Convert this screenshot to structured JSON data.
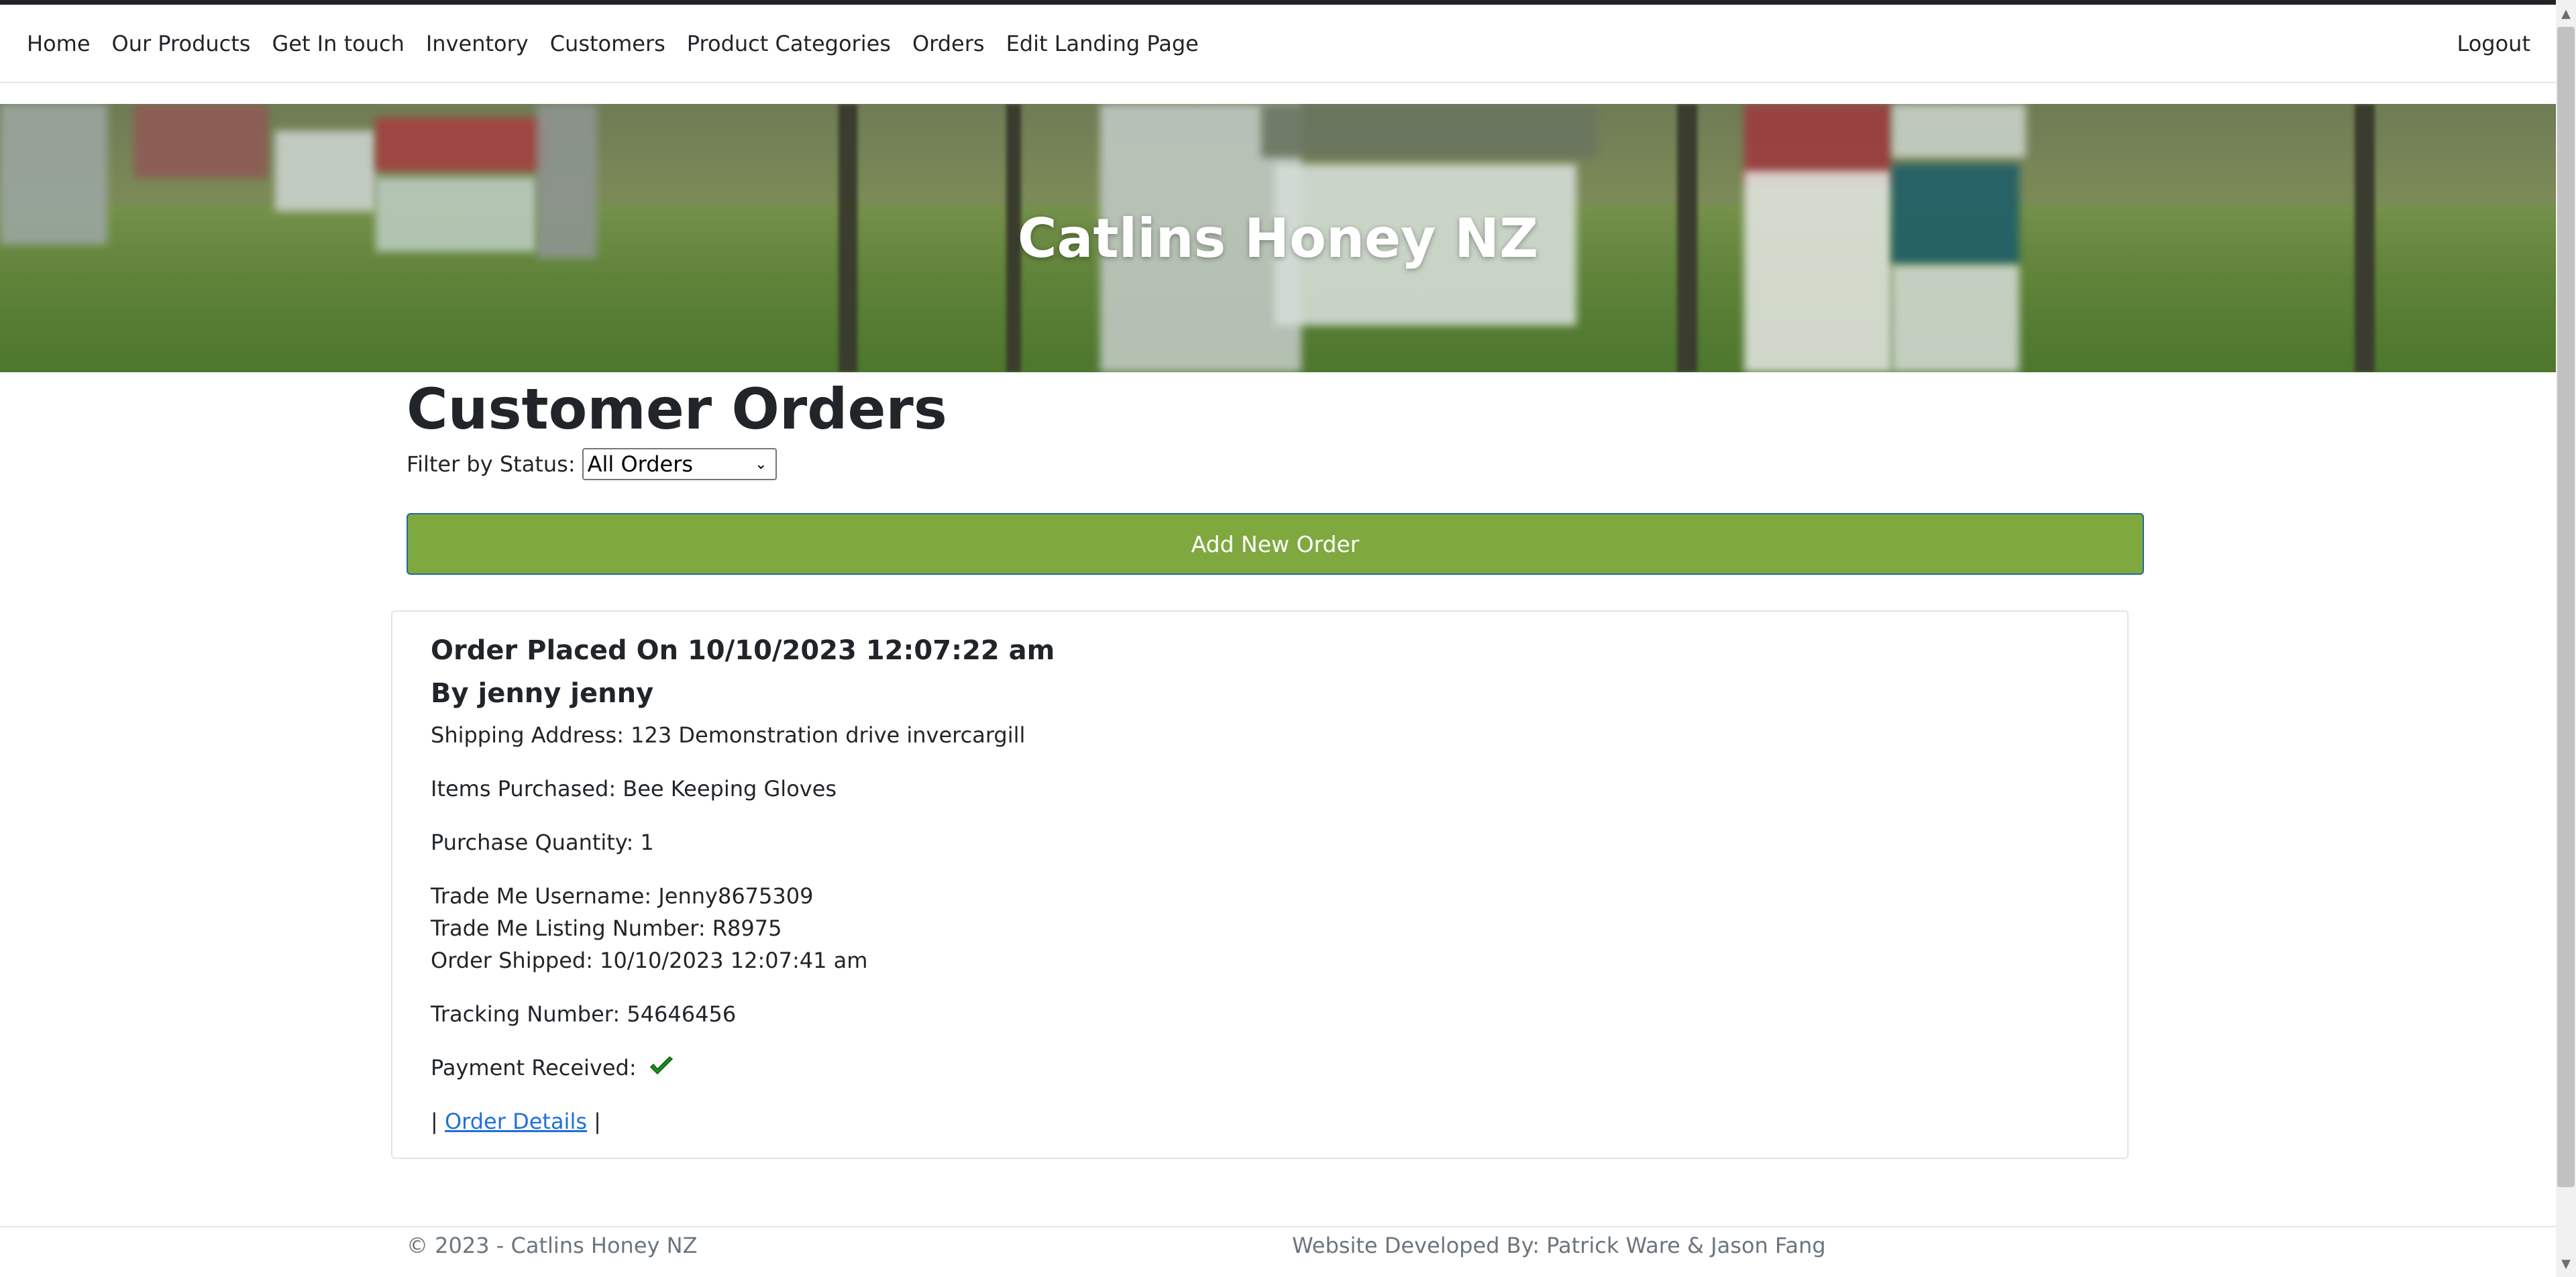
{
  "nav": {
    "links": [
      "Home",
      "Our Products",
      "Get In touch",
      "Inventory",
      "Customers",
      "Product Categories",
      "Orders",
      "Edit Landing Page"
    ],
    "logout": "Logout"
  },
  "hero": {
    "title": "Catlins Honey NZ"
  },
  "main": {
    "title": "Customer Orders",
    "filter_label": "Filter by Status:",
    "filter_value": "All Orders",
    "add_button": "Add New Order"
  },
  "order": {
    "placed": "Order Placed On 10/10/2023 12:07:22 am",
    "by": "By jenny jenny",
    "shipping": "Shipping Address: 123 Demonstration drive invercargill",
    "items": "Items Purchased: Bee Keeping Gloves",
    "quantity": "Purchase Quantity: 1",
    "trademe_user": "Trade Me Username: Jenny8675309",
    "listing": "Trade Me Listing Number: R8975",
    "shipped": "Order Shipped: 10/10/2023 12:07:41 am",
    "tracking": "Tracking Number: 54646456",
    "payment_label": "Payment Received:",
    "payment_icon": "check-icon",
    "details_link": "Order Details",
    "separator": "|"
  },
  "footer": {
    "copyright": "© 2023 - Catlins Honey NZ",
    "developers": "Website Developed By: Patrick Ware & Jason Fang"
  },
  "colors": {
    "accent_green": "#7fa93f",
    "link_blue": "#1f6fdd",
    "check_green": "#1a8f1a"
  }
}
